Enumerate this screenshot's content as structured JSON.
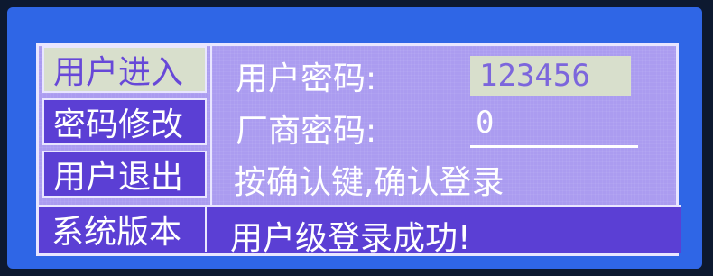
{
  "menu": {
    "items": [
      {
        "label": "用户进入",
        "active": true
      },
      {
        "label": "密码修改",
        "active": false
      },
      {
        "label": "用户退出",
        "active": false
      },
      {
        "label": "系统版本",
        "active": false
      }
    ]
  },
  "form": {
    "user_password_label": "用户密码:",
    "user_password_value": "123456",
    "vendor_password_label": "厂商密码:",
    "vendor_password_value": "0",
    "hint": "按确认键,确认登录"
  },
  "status": {
    "message": "用户级登录成功!"
  },
  "colors": {
    "screen_bg": "#ab9cf0",
    "item_bg": "#5b3fd4",
    "active_bg": "#d8dfcc",
    "panel_blue": "#2f66e6"
  }
}
